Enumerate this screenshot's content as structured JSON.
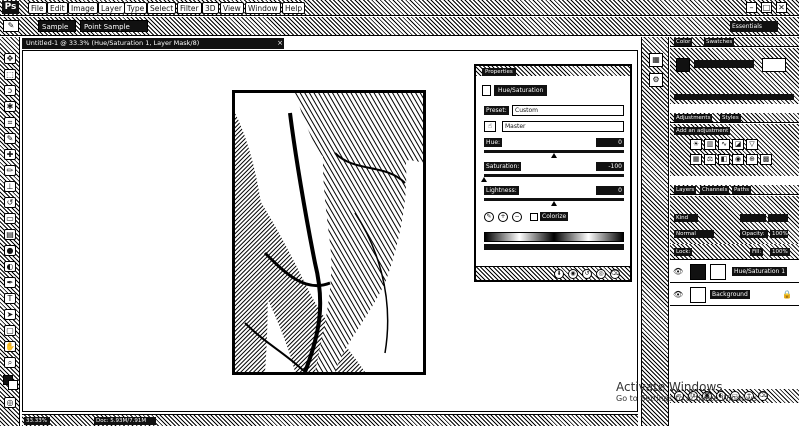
{
  "menubar": {
    "logo": "Ps",
    "items": [
      "File",
      "Edit",
      "Image",
      "Layer",
      "Type",
      "Select",
      "Filter",
      "3D",
      "View",
      "Window",
      "Help"
    ],
    "window_controls": [
      "–",
      "□",
      "✕"
    ]
  },
  "optionsbar": {
    "sample_size": "Sample Size:",
    "sample_value": "Point Sample",
    "workspace": "Essentials"
  },
  "document": {
    "tab_title": "Untitled-1 @ 33.3% (Hue/Saturation 1, Layer Mask/8)",
    "status_zoom": "33.33%",
    "status_doc": "Doc: 5.93M/7.91M"
  },
  "properties": {
    "tab_label": "Properties",
    "title": "Hue/Saturation",
    "preset_label": "Preset:",
    "preset_value": "Custom",
    "channel_value": "Master",
    "hue_label": "Hue:",
    "hue_value": "0",
    "saturation_label": "Saturation:",
    "saturation_value": "-100",
    "lightness_label": "Lightness:",
    "lightness_value": "0",
    "colorize_label": "Colorize",
    "hue_level": 0.5,
    "saturation_level": 0.0,
    "lightness_level": 0.5
  },
  "right_panels": {
    "top_tabs": [
      "Color",
      "Swatches"
    ],
    "adjustments_tab": "Adjustments",
    "styles_tab": "Styles",
    "add_adjustment": "Add an adjustment",
    "layers_tabs": [
      "Layers",
      "Channels",
      "Paths"
    ],
    "kind_label": "Kind",
    "blend_mode": "Normal",
    "opacity_label": "Opacity:",
    "opacity_value": "100%",
    "lock_label": "Lock:",
    "fill_label": "Fill:",
    "fill_value": "100%",
    "layers": [
      {
        "name": "Hue/Saturation 1"
      },
      {
        "name": "Background"
      }
    ]
  },
  "watermark": {
    "line1": "Activate Windows",
    "line2": "Go to Settings to activate Windows."
  },
  "colors": {
    "ink": "#111111",
    "paper": "#ffffff"
  }
}
